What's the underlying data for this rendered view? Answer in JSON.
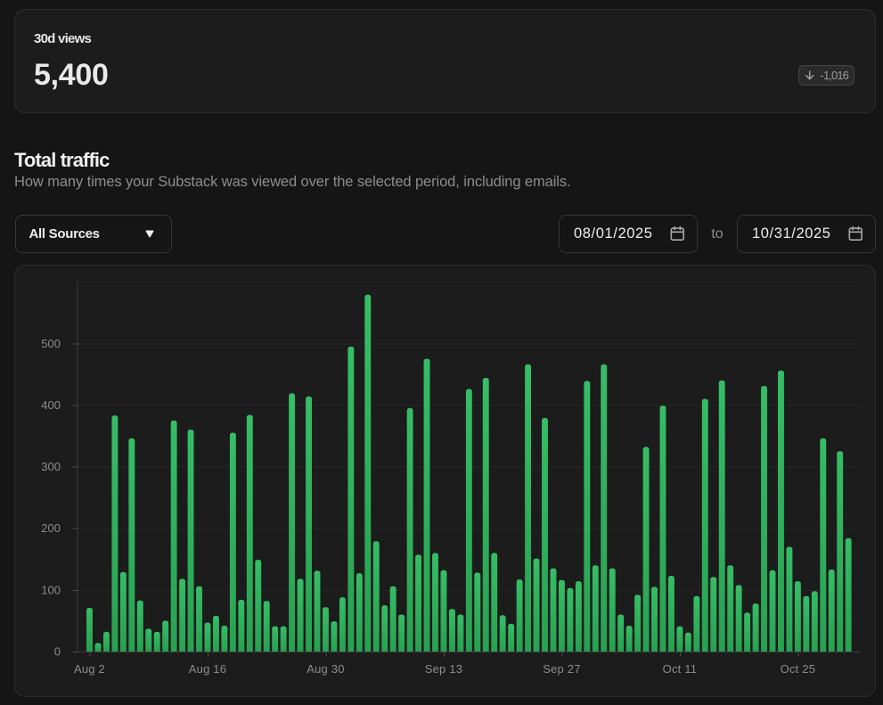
{
  "stat_card": {
    "label": "30d views",
    "value": "5,400",
    "delta": {
      "value": "-1,016",
      "direction": "down"
    }
  },
  "section": {
    "title": "Total traffic",
    "subtitle": "How many times your Substack was viewed over the selected period, including emails."
  },
  "controls": {
    "source_filter": {
      "value": "All Sources"
    },
    "date_from": {
      "value": "08/01/2025"
    },
    "range_separator": "to",
    "date_to": {
      "value": "10/31/2025"
    }
  },
  "icons": {
    "delta_badge": "arrow-down",
    "source_filter": "chevron-down",
    "date_inputs": "calendar"
  },
  "colors": {
    "page_bg": "#151515",
    "card_bg": "#1c1c1c",
    "card_border": "#2e2e2e",
    "bar_gradient_top": "#36bd66",
    "bar_gradient_bottom": "#28a151",
    "gridline": "#262626",
    "axis_line": "#3d3d3d",
    "tick_line": "#4f4f4f",
    "axis_label": "#8c8c8c"
  },
  "chart_data": {
    "type": "bar",
    "title": "Total traffic",
    "xlabel": "",
    "ylabel": "",
    "x": [
      "Aug 2",
      "Aug 3",
      "Aug 4",
      "Aug 5",
      "Aug 6",
      "Aug 7",
      "Aug 8",
      "Aug 9",
      "Aug 10",
      "Aug 11",
      "Aug 12",
      "Aug 13",
      "Aug 14",
      "Aug 15",
      "Aug 16",
      "Aug 17",
      "Aug 18",
      "Aug 19",
      "Aug 20",
      "Aug 21",
      "Aug 22",
      "Aug 23",
      "Aug 24",
      "Aug 25",
      "Aug 26",
      "Aug 27",
      "Aug 28",
      "Aug 29",
      "Aug 30",
      "Aug 31",
      "Sep 1",
      "Sep 2",
      "Sep 3",
      "Sep 4",
      "Sep 5",
      "Sep 6",
      "Sep 7",
      "Sep 8",
      "Sep 9",
      "Sep 10",
      "Sep 11",
      "Sep 12",
      "Sep 13",
      "Sep 14",
      "Sep 15",
      "Sep 16",
      "Sep 17",
      "Sep 18",
      "Sep 19",
      "Sep 20",
      "Sep 21",
      "Sep 22",
      "Sep 23",
      "Sep 24",
      "Sep 25",
      "Sep 26",
      "Sep 27",
      "Sep 28",
      "Sep 29",
      "Sep 30",
      "Oct 1",
      "Oct 2",
      "Oct 3",
      "Oct 4",
      "Oct 5",
      "Oct 6",
      "Oct 7",
      "Oct 8",
      "Oct 9",
      "Oct 10",
      "Oct 11",
      "Oct 12",
      "Oct 13",
      "Oct 14",
      "Oct 15",
      "Oct 16",
      "Oct 17",
      "Oct 18",
      "Oct 19",
      "Oct 20",
      "Oct 21",
      "Oct 22",
      "Oct 23",
      "Oct 24",
      "Oct 25",
      "Oct 26",
      "Oct 27",
      "Oct 28",
      "Oct 29",
      "Oct 30",
      "Oct 31"
    ],
    "values": [
      71,
      14,
      32,
      383,
      129,
      346,
      83,
      37,
      32,
      50,
      375,
      118,
      360,
      106,
      47,
      58,
      42,
      355,
      84,
      384,
      149,
      82,
      41,
      41,
      419,
      118,
      414,
      131,
      72,
      49,
      88,
      495,
      127,
      579,
      179,
      75,
      106,
      60,
      395,
      157,
      475,
      160,
      132,
      69,
      60,
      426,
      128,
      444,
      160,
      59,
      45,
      117,
      466,
      151,
      379,
      135,
      116,
      103,
      114,
      439,
      140,
      466,
      135,
      60,
      42,
      92,
      332,
      105,
      399,
      123,
      41,
      31,
      90,
      410,
      121,
      440,
      140,
      108,
      63,
      78,
      431,
      132,
      456,
      170,
      114,
      90,
      98,
      346,
      133,
      325,
      184
    ],
    "ylim": [
      0,
      600
    ],
    "yticks": [
      0,
      100,
      200,
      300,
      400,
      500
    ],
    "xtick_labels": [
      "Aug 2",
      "Aug 16",
      "Aug 30",
      "Sep 13",
      "Sep 27",
      "Oct 11",
      "Oct 25"
    ],
    "xtick_indices": [
      0,
      14,
      28,
      42,
      56,
      70,
      84
    ],
    "grid": true,
    "legend": false
  }
}
